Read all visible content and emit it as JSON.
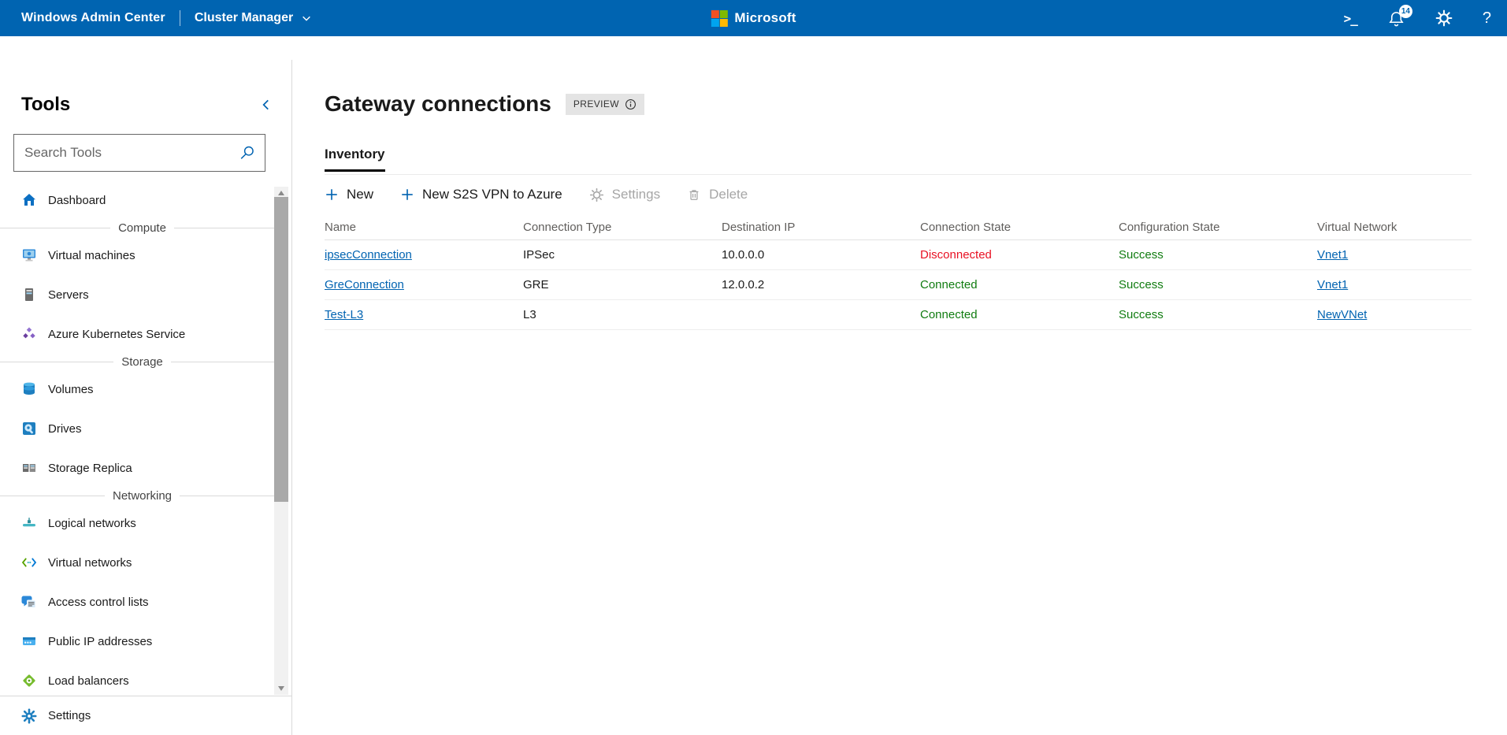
{
  "colors": {
    "topbar_blue": "#0064b1",
    "accent_blue": "#0063b1",
    "link_blue": "#0063b1",
    "error_red": "#e81123",
    "success_green": "#107c10",
    "ms_logo": {
      "red": "#f25022",
      "green": "#7fba00",
      "blue": "#00a4ef",
      "yellow": "#ffb900"
    }
  },
  "topbar": {
    "app_title": "Windows Admin Center",
    "solution_name": "Cluster Manager",
    "brand": "Microsoft",
    "terminal_glyph": ">_",
    "notification_count": "14",
    "help_glyph": "?"
  },
  "sidebar": {
    "title": "Tools",
    "search_placeholder": "Search Tools",
    "items": [
      {
        "type": "item",
        "label": "Dashboard",
        "icon": "home-icon"
      },
      {
        "type": "divider",
        "label": "Compute"
      },
      {
        "type": "item",
        "label": "Virtual machines",
        "icon": "vm-icon"
      },
      {
        "type": "item",
        "label": "Servers",
        "icon": "server-icon"
      },
      {
        "type": "item",
        "label": "Azure Kubernetes Service",
        "icon": "aks-icon"
      },
      {
        "type": "divider",
        "label": "Storage"
      },
      {
        "type": "item",
        "label": "Volumes",
        "icon": "volumes-icon"
      },
      {
        "type": "item",
        "label": "Drives",
        "icon": "drives-icon"
      },
      {
        "type": "item",
        "label": "Storage Replica",
        "icon": "storage-replica-icon"
      },
      {
        "type": "divider",
        "label": "Networking"
      },
      {
        "type": "item",
        "label": "Logical networks",
        "icon": "logical-networks-icon"
      },
      {
        "type": "item",
        "label": "Virtual networks",
        "icon": "virtual-networks-icon"
      },
      {
        "type": "item",
        "label": "Access control lists",
        "icon": "acl-icon"
      },
      {
        "type": "item",
        "label": "Public IP addresses",
        "icon": "public-ip-icon"
      },
      {
        "type": "item",
        "label": "Load balancers",
        "icon": "load-balancer-icon"
      }
    ],
    "footer": {
      "label": "Settings",
      "icon": "gear-icon"
    }
  },
  "main": {
    "title": "Gateway connections",
    "preview_badge": "PREVIEW",
    "tab": "Inventory",
    "toolbar": [
      {
        "label": "New",
        "icon": "plus-icon",
        "enabled": true
      },
      {
        "label": "New S2S VPN to Azure",
        "icon": "plus-icon",
        "enabled": true
      },
      {
        "label": "Settings",
        "icon": "gear-icon",
        "enabled": false
      },
      {
        "label": "Delete",
        "icon": "trash-icon",
        "enabled": false
      }
    ],
    "table": {
      "columns": [
        "Name",
        "Connection Type",
        "Destination IP",
        "Connection State",
        "Configuration State",
        "Virtual Network"
      ],
      "rows": [
        {
          "name": "ipsecConnection",
          "type": "IPSec",
          "destination_ip": "10.0.0.0",
          "connection_state": "Disconnected",
          "connection_state_color": "#e81123",
          "configuration_state": "Success",
          "configuration_state_color": "#107c10",
          "virtual_network": "Vnet1"
        },
        {
          "name": "GreConnection",
          "type": "GRE",
          "destination_ip": "12.0.0.2",
          "connection_state": "Connected",
          "connection_state_color": "#107c10",
          "configuration_state": "Success",
          "configuration_state_color": "#107c10",
          "virtual_network": "Vnet1"
        },
        {
          "name": "Test-L3",
          "type": "L3",
          "destination_ip": "",
          "connection_state": "Connected",
          "connection_state_color": "#107c10",
          "configuration_state": "Success",
          "configuration_state_color": "#107c10",
          "virtual_network": "NewVNet"
        }
      ]
    }
  }
}
